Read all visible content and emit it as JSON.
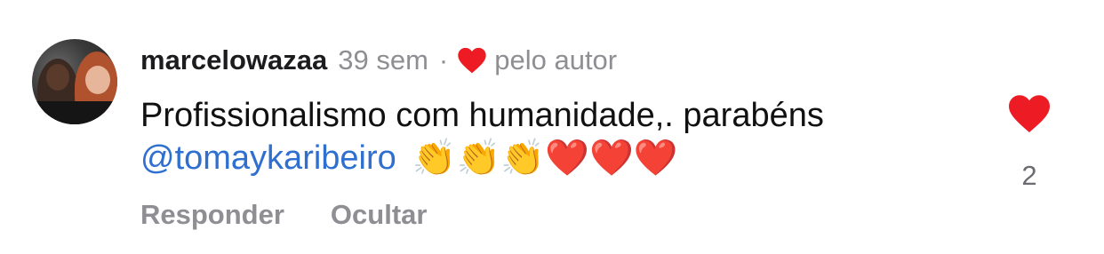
{
  "comment": {
    "username": "marcelowazaa",
    "time": "39 sem",
    "separator": "·",
    "author_badge": "pelo autor",
    "text_line1": "Profissionalismo com humanidade,. parabéns",
    "mention": "@tomaykaribeiro",
    "emojis": "👏👏👏❤️❤️❤️",
    "like_count": "2",
    "accent_color": "#ed1c24",
    "link_color": "#2f6fcf"
  },
  "actions": {
    "reply_label": "Responder",
    "hide_label": "Ocultar"
  },
  "icons": {
    "author_like": "heart-icon",
    "like": "heart-icon"
  }
}
